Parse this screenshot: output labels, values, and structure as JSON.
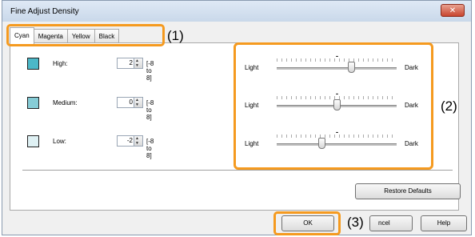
{
  "window": {
    "title": "Fine Adjust Density",
    "close_label": "✕"
  },
  "tabs": [
    {
      "label": "Cyan",
      "active": true
    },
    {
      "label": "Magenta",
      "active": false
    },
    {
      "label": "Yellow",
      "active": false
    },
    {
      "label": "Black",
      "active": false
    }
  ],
  "rows": [
    {
      "label": "High:",
      "value": "2",
      "range": "[-8 to 8]",
      "swatch_color": "#4bb8c8",
      "slider_value": 2
    },
    {
      "label": "Medium:",
      "value": "0",
      "range": "[-8 to 8]",
      "swatch_color": "#86ccd6",
      "slider_value": 0
    },
    {
      "label": "Low:",
      "value": "-2",
      "range": "[-8 to 8]",
      "swatch_color": "#dff1f4",
      "slider_value": -2
    }
  ],
  "slider_labels": {
    "light": "Light",
    "dark": "Dark",
    "center_mark": "-"
  },
  "buttons": {
    "restore_defaults": "Restore Defaults",
    "ok": "OK",
    "cancel": "ncel",
    "help": "Help"
  },
  "callouts": [
    "(1)",
    "(2)",
    "(3)"
  ],
  "colors": {
    "callout": "#f59a1f"
  }
}
